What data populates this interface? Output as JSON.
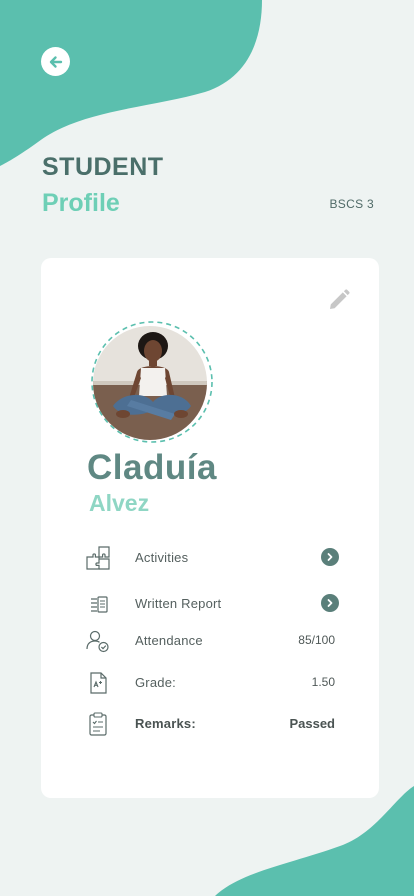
{
  "header": {
    "title_line1": "STUDENT",
    "title_line2": "Profile",
    "class_code": "BSCS 3"
  },
  "student": {
    "first_name": "Claduía",
    "last_name": "Alvez"
  },
  "details": [
    {
      "label": "Activities",
      "value": "",
      "icon": "puzzle-icon",
      "action": "chevron-right-icon"
    },
    {
      "label": "Written Report",
      "value": "",
      "icon": "report-list-icon",
      "action": "chevron-right-icon"
    },
    {
      "label": "Attendance",
      "value": "85/100",
      "icon": "user-check-icon"
    },
    {
      "label": "Grade:",
      "value": "1.50",
      "icon": "grade-document-icon"
    },
    {
      "label": "Remarks:",
      "value": "Passed",
      "icon": "clipboard-icon"
    }
  ],
  "colors": {
    "accent": "#5bbfae",
    "background": "#eef3f2",
    "heading": "#4a6f6a",
    "highlight": "#6ecfb6"
  }
}
